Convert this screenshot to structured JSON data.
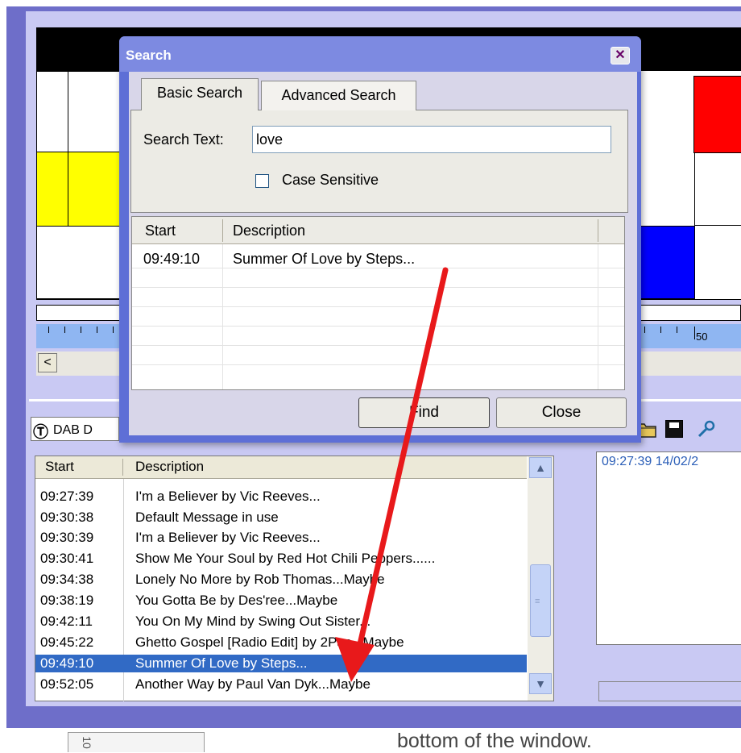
{
  "dialog": {
    "title": "Search",
    "close_glyph": "✕",
    "tabs": [
      {
        "label": "Basic Search",
        "active": true
      },
      {
        "label": "Advanced Search",
        "active": false
      }
    ],
    "search_label": "Search Text:",
    "search_value": "love",
    "case_sensitive_label": "Case Sensitive",
    "case_sensitive_checked": false,
    "results": {
      "columns": [
        "Start",
        "Description"
      ],
      "rows": [
        {
          "start": "09:49:10",
          "description": "Summer Of Love by Steps..."
        }
      ]
    },
    "find_label": "Find",
    "close_label": "Close"
  },
  "timeline": {
    "ruler_label": "50",
    "scroll_left_glyph": "<",
    "colors": {
      "yellow": "#ffff00",
      "red": "#ff0000",
      "blue": "#0000ff"
    }
  },
  "dab": {
    "logo_glyph": "Ⓣ",
    "label": "DAB D"
  },
  "toolbar": {
    "icons": [
      "folder-icon",
      "save-icon",
      "search-key-icon"
    ]
  },
  "event_list": {
    "columns": [
      "Start",
      "Description"
    ],
    "rows": [
      {
        "start": "09:27:39",
        "description": "I'm a Believer by Vic Reeves..."
      },
      {
        "start": "09:30:38",
        "description": "Default Message in use"
      },
      {
        "start": "09:30:39",
        "description": "I'm a Believer by Vic Reeves..."
      },
      {
        "start": "09:30:41",
        "description": "Show Me Your Soul by Red Hot Chili Peppers......"
      },
      {
        "start": "09:34:38",
        "description": "Lonely No More by Rob Thomas...Maybe"
      },
      {
        "start": "09:38:19",
        "description": "You Gotta Be by Des'ree...Maybe"
      },
      {
        "start": "09:42:11",
        "description": "You On My Mind by Swing Out Sister..."
      },
      {
        "start": "09:45:22",
        "description": "Ghetto Gospel [Radio Edit] by 2Pac...Maybe"
      },
      {
        "start": "09:49:10",
        "description": "Summer Of Love by Steps...",
        "selected": true
      },
      {
        "start": "09:52:05",
        "description": "Another Way by Paul Van Dyk...Maybe"
      }
    ],
    "scroll_up_glyph": "▲",
    "scroll_down_glyph": "▼",
    "grip_glyph": "≡"
  },
  "right_panel": {
    "text": "09:27:39 14/02/2"
  },
  "document": {
    "caption": "bottom of the window.",
    "tab_number": "10"
  },
  "annotation": {
    "arrow_color": "#e8191b"
  }
}
